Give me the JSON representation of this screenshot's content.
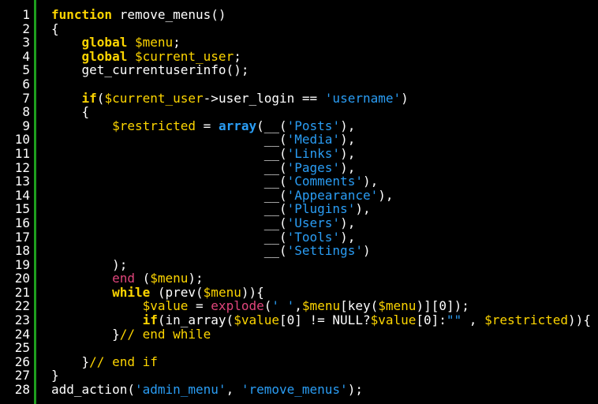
{
  "editor": {
    "colors": {
      "background": "#000000",
      "gutter_border": "#1e9e1e",
      "keyword": "#fdd500",
      "variable": "#fdd500",
      "string": "#2a9df4",
      "function_call": "#e0457b",
      "comment": "#fdd500",
      "text": "#ffffff"
    },
    "lines": [
      {
        "n": "1",
        "tokens": [
          [
            "kw",
            "function"
          ],
          [
            "t",
            " remove_menus()"
          ]
        ]
      },
      {
        "n": "2",
        "tokens": [
          [
            "t",
            "{"
          ]
        ]
      },
      {
        "n": "3",
        "tokens": [
          [
            "t",
            "    "
          ],
          [
            "kw",
            "global"
          ],
          [
            "t",
            " "
          ],
          [
            "var",
            "$menu"
          ],
          [
            "t",
            ";"
          ]
        ]
      },
      {
        "n": "4",
        "tokens": [
          [
            "t",
            "    "
          ],
          [
            "kw",
            "global"
          ],
          [
            "t",
            " "
          ],
          [
            "var",
            "$current_user"
          ],
          [
            "t",
            ";"
          ]
        ]
      },
      {
        "n": "5",
        "tokens": [
          [
            "t",
            "    get_currentuserinfo();"
          ]
        ]
      },
      {
        "n": "6",
        "tokens": []
      },
      {
        "n": "7",
        "tokens": [
          [
            "t",
            "    "
          ],
          [
            "kw",
            "if"
          ],
          [
            "t",
            "("
          ],
          [
            "var",
            "$current_user"
          ],
          [
            "t",
            "->user_login == "
          ],
          [
            "str",
            "'username'"
          ],
          [
            "t",
            ")"
          ]
        ]
      },
      {
        "n": "8",
        "tokens": [
          [
            "t",
            "    {"
          ]
        ]
      },
      {
        "n": "9",
        "tokens": [
          [
            "t",
            "        "
          ],
          [
            "var",
            "$restricted"
          ],
          [
            "t",
            " = "
          ],
          [
            "bi",
            "array"
          ],
          [
            "t",
            "(__("
          ],
          [
            "str",
            "'Posts'"
          ],
          [
            "t",
            "),"
          ]
        ]
      },
      {
        "n": "10",
        "tokens": [
          [
            "t",
            "                            __("
          ],
          [
            "str",
            "'Media'"
          ],
          [
            "t",
            "),"
          ]
        ]
      },
      {
        "n": "11",
        "tokens": [
          [
            "t",
            "                            __("
          ],
          [
            "str",
            "'Links'"
          ],
          [
            "t",
            "),"
          ]
        ]
      },
      {
        "n": "12",
        "tokens": [
          [
            "t",
            "                            __("
          ],
          [
            "str",
            "'Pages'"
          ],
          [
            "t",
            "),"
          ]
        ]
      },
      {
        "n": "13",
        "tokens": [
          [
            "t",
            "                            __("
          ],
          [
            "str",
            "'Comments'"
          ],
          [
            "t",
            "),"
          ]
        ]
      },
      {
        "n": "14",
        "tokens": [
          [
            "t",
            "                            __("
          ],
          [
            "str",
            "'Appearance'"
          ],
          [
            "t",
            "),"
          ]
        ]
      },
      {
        "n": "15",
        "tokens": [
          [
            "t",
            "                            __("
          ],
          [
            "str",
            "'Plugins'"
          ],
          [
            "t",
            "),"
          ]
        ]
      },
      {
        "n": "16",
        "tokens": [
          [
            "t",
            "                            __("
          ],
          [
            "str",
            "'Users'"
          ],
          [
            "t",
            "),"
          ]
        ]
      },
      {
        "n": "17",
        "tokens": [
          [
            "t",
            "                            __("
          ],
          [
            "str",
            "'Tools'"
          ],
          [
            "t",
            "),"
          ]
        ]
      },
      {
        "n": "18",
        "tokens": [
          [
            "t",
            "                            __("
          ],
          [
            "str",
            "'Settings'"
          ],
          [
            "t",
            ")"
          ]
        ]
      },
      {
        "n": "19",
        "tokens": [
          [
            "t",
            "        );"
          ]
        ]
      },
      {
        "n": "20",
        "tokens": [
          [
            "t",
            "        "
          ],
          [
            "kwr",
            "end"
          ],
          [
            "t",
            " ("
          ],
          [
            "var",
            "$menu"
          ],
          [
            "t",
            ");"
          ]
        ]
      },
      {
        "n": "21",
        "tokens": [
          [
            "t",
            "        "
          ],
          [
            "kw",
            "while"
          ],
          [
            "t",
            " (prev("
          ],
          [
            "var",
            "$menu"
          ],
          [
            "t",
            ")){"
          ]
        ]
      },
      {
        "n": "22",
        "tokens": [
          [
            "t",
            "            "
          ],
          [
            "var",
            "$value"
          ],
          [
            "t",
            " = "
          ],
          [
            "fn",
            "explode"
          ],
          [
            "t",
            "("
          ],
          [
            "str",
            "' '"
          ],
          [
            "t",
            ","
          ],
          [
            "var",
            "$menu"
          ],
          [
            "t",
            "[key("
          ],
          [
            "var",
            "$menu"
          ],
          [
            "t",
            ")][0]);"
          ]
        ]
      },
      {
        "n": "23",
        "tokens": [
          [
            "t",
            "            "
          ],
          [
            "kw",
            "if"
          ],
          [
            "t",
            "(in_array("
          ],
          [
            "var",
            "$value"
          ],
          [
            "t",
            "[0] != NULL?"
          ],
          [
            "var",
            "$value"
          ],
          [
            "t",
            "[0]:"
          ],
          [
            "str",
            "\"\""
          ],
          [
            "t",
            " , "
          ],
          [
            "var",
            "$restricted"
          ],
          [
            "t",
            ")){"
          ]
        ]
      },
      {
        "n": "24",
        "tokens": [
          [
            "t",
            "        }"
          ],
          [
            "com",
            "// end while"
          ]
        ]
      },
      {
        "n": "25",
        "tokens": []
      },
      {
        "n": "26",
        "tokens": [
          [
            "t",
            "    }"
          ],
          [
            "com",
            "// end if"
          ]
        ]
      },
      {
        "n": "27",
        "tokens": [
          [
            "t",
            "}"
          ]
        ]
      },
      {
        "n": "28",
        "tokens": [
          [
            "t",
            "add_action("
          ],
          [
            "str",
            "'admin_menu'"
          ],
          [
            "t",
            ", "
          ],
          [
            "str",
            "'remove_menus'"
          ],
          [
            "t",
            ");"
          ]
        ]
      }
    ]
  }
}
